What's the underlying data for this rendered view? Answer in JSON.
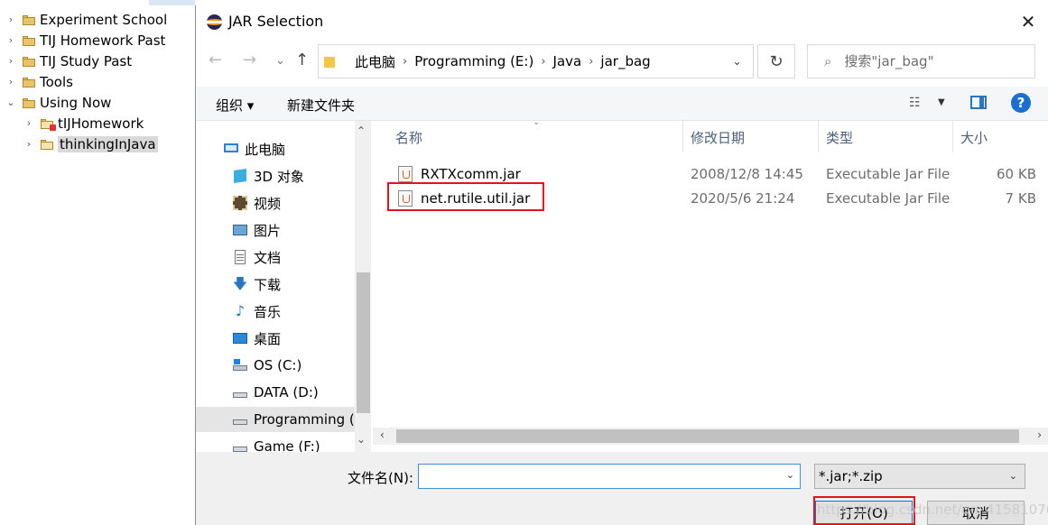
{
  "tree": {
    "items": [
      {
        "label": "Experiment School",
        "arrow": "›",
        "kind": "folder"
      },
      {
        "label": "TIJ Homework Past",
        "arrow": "›",
        "kind": "folder"
      },
      {
        "label": "TIJ Study Past",
        "arrow": "›",
        "kind": "folder"
      },
      {
        "label": "Tools",
        "arrow": "›",
        "kind": "folder"
      },
      {
        "label": "Using Now",
        "arrow": "⌄",
        "kind": "folder"
      },
      {
        "label": "tIJHomework",
        "arrow": "›",
        "kind": "project"
      },
      {
        "label": "thinkingInJava",
        "arrow": "›",
        "kind": "project",
        "selected": true
      }
    ]
  },
  "dialog": {
    "title": "JAR Selection",
    "close_glyph": "✕",
    "nav": {
      "back": "←",
      "forward": "→",
      "down": "⌄",
      "up": "↑"
    },
    "address": {
      "crumbs": [
        "此电脑",
        "Programming (E:)",
        "Java",
        "jar_bag"
      ],
      "separator": "›",
      "dropdown": "⌄"
    },
    "refresh_glyph": "↻",
    "search": {
      "placeholder": "搜索\"jar_bag\"",
      "icon": "search-icon"
    },
    "toolbar": {
      "organize": "组织 ▾",
      "new_folder": "新建文件夹",
      "view_glyph": "☷",
      "view_dropdown": "▼",
      "help": "?"
    },
    "nav_pane": {
      "items": [
        {
          "label": "此电脑",
          "icon": "computer-icon"
        },
        {
          "label": "3D 对象",
          "icon": "3d-objects-icon"
        },
        {
          "label": "视频",
          "icon": "video-icon"
        },
        {
          "label": "图片",
          "icon": "pictures-icon"
        },
        {
          "label": "文档",
          "icon": "documents-icon"
        },
        {
          "label": "下载",
          "icon": "download-icon"
        },
        {
          "label": "音乐",
          "icon": "music-icon"
        },
        {
          "label": "桌面",
          "icon": "desktop-icon"
        },
        {
          "label": "OS (C:)",
          "icon": "drive-c-icon"
        },
        {
          "label": "DATA (D:)",
          "icon": "drive-icon"
        },
        {
          "label": "Programming (",
          "icon": "drive-icon",
          "active": true
        },
        {
          "label": "Game (F:)",
          "icon": "drive-icon"
        }
      ],
      "scroll_up": "⌃",
      "scroll_down": "⌄"
    },
    "columns": [
      "名称",
      "修改日期",
      "类型",
      "大小"
    ],
    "sort_glyph": "⌄",
    "files": [
      {
        "name": "RXTXcomm.jar",
        "date": "2008/12/8 14:45",
        "type": "Executable Jar File",
        "size": "60 KB"
      },
      {
        "name": "net.rutile.util.jar",
        "date": "2020/5/6 21:24",
        "type": "Executable Jar File",
        "size": "7 KB",
        "highlighted": true
      }
    ],
    "hscroll": {
      "left": "‹",
      "right": "›"
    },
    "bottom": {
      "filename_label": "文件名(N):",
      "filename_value": "",
      "filter_value": "*.jar;*.zip",
      "dropdown": "⌄",
      "open_label": "打开(O)",
      "cancel_label": "取消",
      "watermark": "https://blog.csdn.net/qq_41581076"
    }
  },
  "colors": {
    "highlight": "#e3141b",
    "accent": "#0078d7"
  }
}
